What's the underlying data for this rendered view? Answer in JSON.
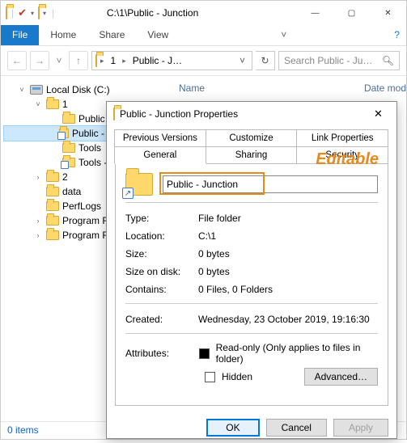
{
  "window": {
    "title": "C:\\1\\Public - Junction",
    "min": "—",
    "max": "▢",
    "close": "✕"
  },
  "ribbon": {
    "file": "File",
    "home": "Home",
    "share": "Share",
    "view": "View"
  },
  "address": {
    "seg1": "1",
    "seg2": "Public - J…",
    "search_placeholder": "Search Public - Ju…"
  },
  "columns": {
    "name": "Name",
    "date": "Date mod"
  },
  "tree": {
    "root": "Local Disk (C:)",
    "n1": "1",
    "n1a": "Public",
    "n1b": "Public - Junction",
    "n1c": "Tools",
    "n1d": "Tools - Smart",
    "n2": "2",
    "n3": "data",
    "n4": "PerfLogs",
    "n5": "Program Files",
    "n6": "Program Files ("
  },
  "status": "0 items",
  "dialog": {
    "title": "Public - Junction Properties",
    "tabs": {
      "prev": "Previous Versions",
      "cust": "Customize",
      "link": "Link Properties",
      "gen": "General",
      "share": "Sharing",
      "sec": "Security"
    },
    "name_value": "Public - Junction",
    "annotation": "Editable",
    "rows": {
      "type_k": "Type:",
      "type_v": "File folder",
      "loc_k": "Location:",
      "loc_v": "C:\\1",
      "size_k": "Size:",
      "size_v": "0 bytes",
      "disk_k": "Size on disk:",
      "disk_v": "0 bytes",
      "cont_k": "Contains:",
      "cont_v": "0 Files, 0 Folders",
      "created_k": "Created:",
      "created_v": "Wednesday, 23 October 2019, 19:16:30",
      "attr_k": "Attributes:",
      "readonly": "Read-only (Only applies to files in folder)",
      "hidden": "Hidden",
      "advanced": "Advanced…"
    },
    "buttons": {
      "ok": "OK",
      "cancel": "Cancel",
      "apply": "Apply"
    }
  }
}
